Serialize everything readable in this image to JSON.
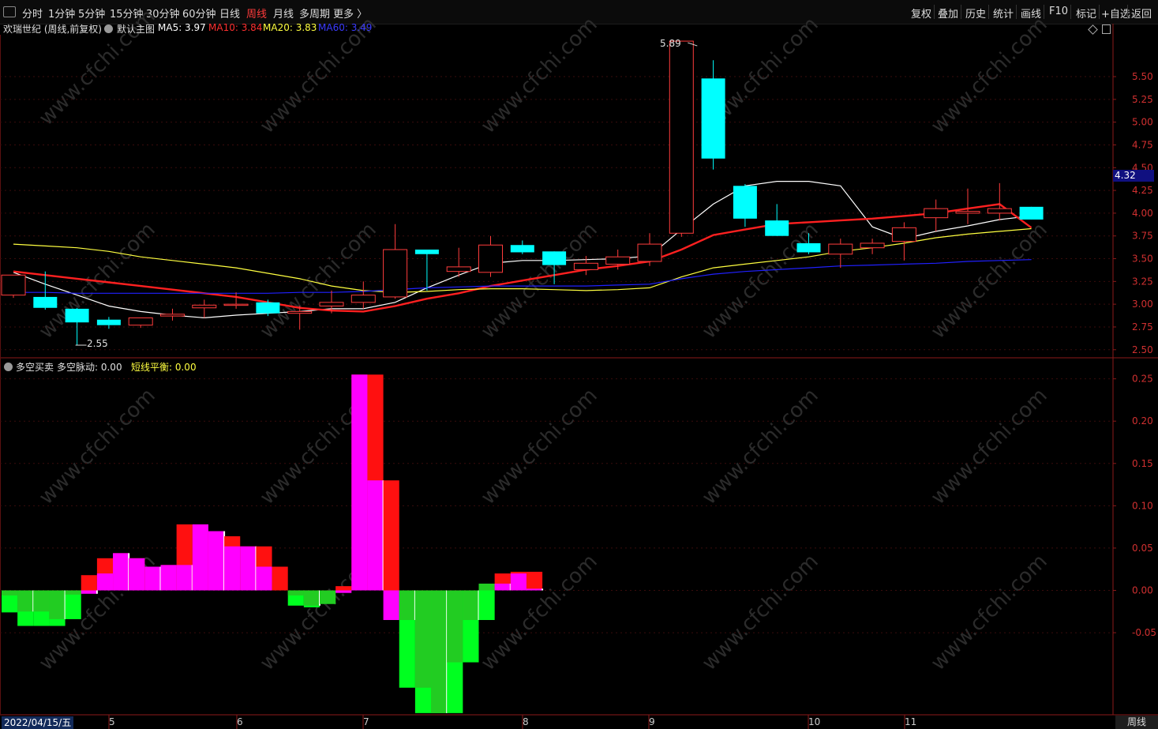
{
  "toolbar": {
    "back_icon": "back-arrow-icon",
    "periods": [
      "分时",
      "1分钟",
      "5分钟",
      "15分钟",
      "30分钟",
      "60分钟",
      "日线",
      "周线",
      "月线",
      "多周期",
      "更多 〉"
    ],
    "active_period": "周线",
    "right_buttons": [
      "复权",
      "叠加",
      "历史",
      "统计",
      "画线",
      "F10",
      "标记",
      "+自选",
      "返回"
    ]
  },
  "main_panel": {
    "title": "欢瑞世纪 (周线,前复权)",
    "template": "默认主图",
    "ma5": "MA5: 3.97",
    "ma10": "MA10: 3.84",
    "ma20": "MA20: 3.83",
    "ma60": "MA60: 3.49",
    "current_price_tag": "4.32",
    "high_label": "5.89",
    "low_label": "2.55",
    "colors": {
      "up": "#ff3c3c",
      "down": "#00ffff",
      "ma5": "#ffffff",
      "ma10": "#ff2020",
      "ma20": "#ffff40",
      "ma60": "#2020ff"
    }
  },
  "sub_panel": {
    "name": "多空买卖",
    "line1": "多空脉动: 0.00",
    "line2": "短线平衡: 0.00"
  },
  "x_axis": {
    "start_date": "2022/04/15/五",
    "months": [
      "5",
      "6",
      "7",
      "8",
      "9",
      "10",
      "11"
    ],
    "period_label": "周线"
  },
  "watermark": "www.cfchi.com",
  "chart_data": [
    {
      "type": "candlestick",
      "title": "欢瑞世纪 (周线,前复权)",
      "y_ticks": [
        5.5,
        5.25,
        5.0,
        4.75,
        4.5,
        4.25,
        4.0,
        3.75,
        3.5,
        3.25,
        3.0,
        2.75,
        2.5
      ],
      "ylim": [
        2.42,
        5.96
      ],
      "candles": [
        {
          "o": 3.1,
          "h": 3.15,
          "l": 3.07,
          "c": 3.32
        },
        {
          "o": 3.08,
          "h": 3.36,
          "l": 2.94,
          "c": 2.96
        },
        {
          "o": 2.95,
          "h": 2.96,
          "l": 2.55,
          "c": 2.8
        },
        {
          "o": 2.83,
          "h": 2.86,
          "l": 2.73,
          "c": 2.77
        },
        {
          "o": 2.77,
          "h": 2.85,
          "l": 2.74,
          "c": 2.85
        },
        {
          "o": 2.87,
          "h": 2.95,
          "l": 2.82,
          "c": 2.89
        },
        {
          "o": 2.96,
          "h": 3.05,
          "l": 2.85,
          "c": 2.99
        },
        {
          "o": 3.0,
          "h": 3.13,
          "l": 2.95,
          "c": 3.0
        },
        {
          "o": 3.02,
          "h": 3.05,
          "l": 2.87,
          "c": 2.9
        },
        {
          "o": 2.9,
          "h": 2.98,
          "l": 2.72,
          "c": 2.92
        },
        {
          "o": 2.98,
          "h": 3.15,
          "l": 2.9,
          "c": 3.02
        },
        {
          "o": 3.02,
          "h": 3.25,
          "l": 2.95,
          "c": 3.1
        },
        {
          "o": 3.08,
          "h": 3.88,
          "l": 3.06,
          "c": 3.6
        },
        {
          "o": 3.6,
          "h": 3.53,
          "l": 3.15,
          "c": 3.55
        },
        {
          "o": 3.36,
          "h": 3.62,
          "l": 3.3,
          "c": 3.41
        },
        {
          "o": 3.35,
          "h": 3.75,
          "l": 3.3,
          "c": 3.65
        },
        {
          "o": 3.65,
          "h": 3.7,
          "l": 3.55,
          "c": 3.57
        },
        {
          "o": 3.58,
          "h": 3.53,
          "l": 3.22,
          "c": 3.43
        },
        {
          "o": 3.38,
          "h": 3.53,
          "l": 3.32,
          "c": 3.45
        },
        {
          "o": 3.44,
          "h": 3.6,
          "l": 3.38,
          "c": 3.52
        },
        {
          "o": 3.47,
          "h": 3.78,
          "l": 3.42,
          "c": 3.66
        },
        {
          "o": 3.78,
          "h": 5.89,
          "l": 3.74,
          "c": 5.89
        },
        {
          "o": 5.48,
          "h": 5.68,
          "l": 4.48,
          "c": 4.6
        },
        {
          "o": 4.3,
          "h": 4.32,
          "l": 3.85,
          "c": 3.94
        },
        {
          "o": 3.92,
          "h": 4.1,
          "l": 3.75,
          "c": 3.75
        },
        {
          "o": 3.67,
          "h": 3.78,
          "l": 3.55,
          "c": 3.57
        },
        {
          "o": 3.55,
          "h": 3.72,
          "l": 3.4,
          "c": 3.66
        },
        {
          "o": 3.62,
          "h": 3.72,
          "l": 3.55,
          "c": 3.67
        },
        {
          "o": 3.69,
          "h": 3.9,
          "l": 3.48,
          "c": 3.84
        },
        {
          "o": 3.95,
          "h": 4.15,
          "l": 3.8,
          "c": 4.05
        },
        {
          "o": 4.0,
          "h": 4.27,
          "l": 3.88,
          "c": 4.02
        },
        {
          "o": 4.0,
          "h": 4.33,
          "l": 3.92,
          "c": 4.05
        },
        {
          "o": 4.07,
          "h": 4.06,
          "l": 3.93,
          "c": 3.93
        }
      ],
      "ma_series": [
        {
          "name": "MA5",
          "values": [
            3.35,
            3.22,
            3.1,
            2.98,
            2.92,
            2.88,
            2.85,
            2.88,
            2.9,
            2.92,
            2.95,
            2.95,
            3.02,
            3.18,
            3.32,
            3.45,
            3.48,
            3.48,
            3.49,
            3.5,
            3.53,
            3.82,
            4.1,
            4.3,
            4.35,
            4.35,
            4.3,
            3.85,
            3.72,
            3.8,
            3.86,
            3.93,
            3.97
          ]
        },
        {
          "name": "MA10",
          "values": [
            3.36,
            3.32,
            3.28,
            3.24,
            3.2,
            3.16,
            3.12,
            3.08,
            3.02,
            2.96,
            2.93,
            2.92,
            2.98,
            3.06,
            3.12,
            3.2,
            3.26,
            3.32,
            3.38,
            3.42,
            3.47,
            3.6,
            3.76,
            3.82,
            3.88,
            3.9,
            3.92,
            3.94,
            3.97,
            4.0,
            4.05,
            4.1,
            3.84
          ]
        },
        {
          "name": "MA20",
          "values": [
            3.66,
            3.64,
            3.62,
            3.58,
            3.52,
            3.48,
            3.44,
            3.4,
            3.34,
            3.28,
            3.2,
            3.15,
            3.13,
            3.14,
            3.16,
            3.17,
            3.17,
            3.16,
            3.15,
            3.16,
            3.18,
            3.3,
            3.4,
            3.44,
            3.48,
            3.52,
            3.58,
            3.62,
            3.67,
            3.73,
            3.77,
            3.8,
            3.83
          ]
        },
        {
          "name": "MA60",
          "values": [
            3.13,
            3.13,
            3.12,
            3.12,
            3.12,
            3.12,
            3.12,
            3.12,
            3.12,
            3.13,
            3.13,
            3.14,
            3.16,
            3.18,
            3.19,
            3.2,
            3.2,
            3.2,
            3.2,
            3.21,
            3.22,
            3.28,
            3.33,
            3.36,
            3.38,
            3.4,
            3.42,
            3.43,
            3.44,
            3.45,
            3.47,
            3.48,
            3.49
          ]
        }
      ]
    },
    {
      "type": "bar",
      "title": "多空买卖",
      "y_ticks": [
        0.25,
        0.2,
        0.15,
        0.1,
        0.05,
        0.0,
        -0.05
      ],
      "ylim": [
        -0.147,
        0.273
      ],
      "series": [
        {
          "name": "多空脉动",
          "values": [
            -0.026,
            -0.042,
            -0.042,
            -0.034,
            -0.005,
            0.018,
            0.038,
            0.044,
            0.038,
            0.028,
            0.03,
            0.078,
            0.078,
            0.07,
            0.052,
            0.052,
            0.028,
            0.0,
            -0.018,
            -0.02,
            -0.016,
            0.005,
            0.255,
            0.13,
            -0.035,
            -0.115,
            -0.145,
            -0.145,
            -0.085,
            -0.035,
            0.008,
            0.02,
            0.022,
            0.002
          ]
        },
        {
          "name": "短线平衡",
          "values": [
            -0.006,
            -0.025,
            -0.025,
            -0.042,
            -0.034,
            -0.004,
            0.02,
            0.044,
            0.038,
            0.028,
            0.03,
            0.03,
            0.078,
            0.07,
            0.064,
            0.052,
            0.052,
            0.028,
            -0.006,
            -0.018,
            -0.016,
            -0.003,
            0.255,
            0.255,
            0.13,
            -0.035,
            -0.115,
            -0.145,
            -0.145,
            -0.085,
            -0.035,
            0.008,
            0.02,
            0.022
          ]
        }
      ]
    }
  ]
}
